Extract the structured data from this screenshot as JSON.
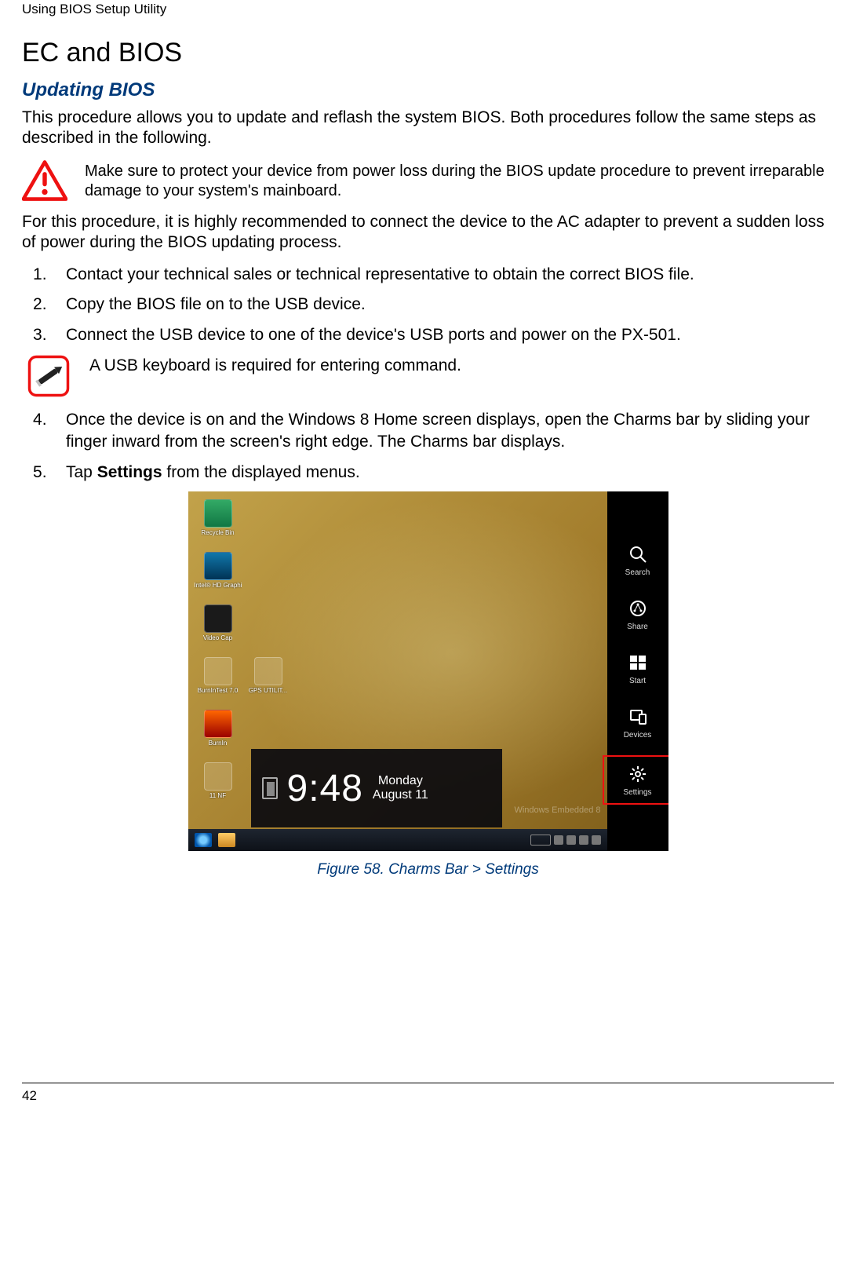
{
  "header": {
    "path": "Using BIOS Setup Utility"
  },
  "section": {
    "title": "EC and BIOS"
  },
  "subsection": {
    "title": "Updating BIOS"
  },
  "intro": "This procedure allows you to update and reflash the system BIOS. Both procedures follow the same steps as described in the following.",
  "warning": {
    "text": "Make sure to protect your device from power loss during the BIOS update procedure to prevent irreparable damage to your system's mainboard."
  },
  "pre_steps": "For this procedure, it is highly recommended to connect the device to the AC adapter to prevent a sudden loss of power during the BIOS updating process.",
  "steps": {
    "s1": "Contact your technical sales or technical representative to obtain the correct BIOS file.",
    "s2": "Copy the BIOS file on to the USB device.",
    "s3": "Connect the USB device to one of the device's USB ports and power on the PX-501.",
    "s4": "Once the device is on and the Windows 8 Home screen displays, open the Charms bar by sliding your finger inward from the screen's right edge. The Charms bar displays.",
    "s5_pre": "Tap ",
    "s5_strong": "Settings",
    "s5_post": " from the displayed menus."
  },
  "note": {
    "text": "A USB keyboard is required for entering command."
  },
  "screenshot": {
    "desktop_icons": {
      "recycle": "Recycle Bin",
      "intel": "Intel® HD Graphics C...",
      "videocap": "Video Cap",
      "burntest": "BurnInTest 7.0",
      "gps": "GPS UTILIT...",
      "burnin": "BurnIn",
      "lastrow1": "11 NF"
    },
    "clock": {
      "time": "9:48",
      "day": "Monday",
      "date": "August 11"
    },
    "watermark": "Windows Embedded 8",
    "charms": {
      "search": "Search",
      "share": "Share",
      "start": "Start",
      "devices": "Devices",
      "settings": "Settings"
    }
  },
  "figure": {
    "caption": "Figure 58.  Charms Bar > Settings"
  },
  "footer": {
    "page": "42"
  }
}
